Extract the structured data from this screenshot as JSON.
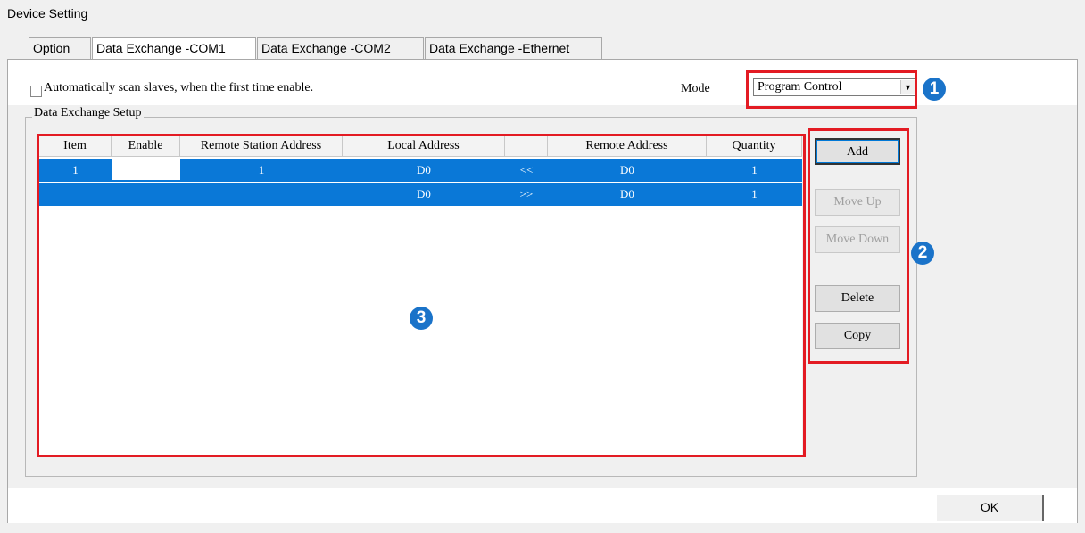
{
  "window": {
    "title": "Device Setting"
  },
  "tabs": [
    {
      "label": "Option",
      "active": false
    },
    {
      "label": "Data Exchange -COM1",
      "active": true
    },
    {
      "label": "Data Exchange -COM2",
      "active": false
    },
    {
      "label": "Data Exchange -Ethernet",
      "active": false
    }
  ],
  "auto_scan": {
    "label": "Automatically scan slaves, when the first time enable.",
    "checked": false
  },
  "mode": {
    "label": "Mode",
    "value": "Program Control"
  },
  "group": {
    "legend": "Data Exchange Setup"
  },
  "table": {
    "headers": [
      "Item",
      "Enable",
      "Remote Station Address",
      "Local Address",
      "",
      "Remote Address",
      "Quantity"
    ],
    "rows": [
      {
        "item": "1",
        "enable": "",
        "remote_station": "1",
        "local": "D0",
        "direction": "<<",
        "remote": "D0",
        "quantity": "1"
      },
      {
        "item": "",
        "enable": "",
        "remote_station": "",
        "local": "D0",
        "direction": ">>",
        "remote": "D0",
        "quantity": "1"
      }
    ]
  },
  "buttons": {
    "add": "Add",
    "move_up": "Move Up",
    "move_down": "Move Down",
    "delete": "Delete",
    "copy": "Copy",
    "ok": "OK"
  },
  "markers": [
    "1",
    "2",
    "3"
  ],
  "colors": {
    "highlight": "#0a78d7",
    "annotation_red": "#e31b23",
    "marker_blue": "#1a73c9"
  }
}
